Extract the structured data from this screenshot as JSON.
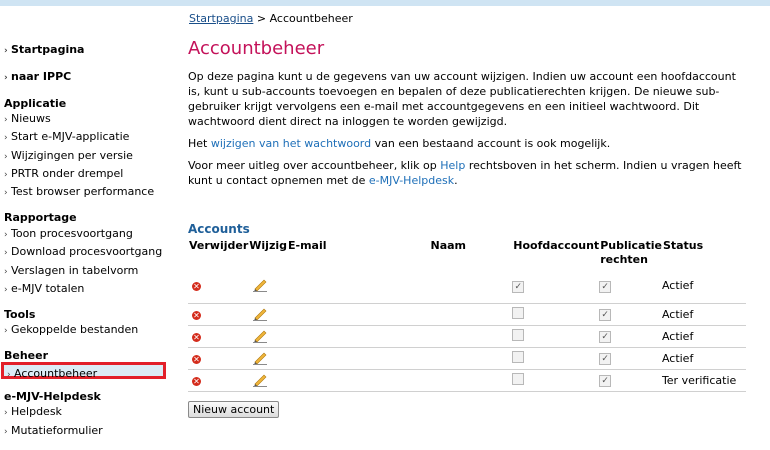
{
  "breadcrumb": {
    "home": "Startpagina",
    "separator": ">",
    "current": "Accountbeheer"
  },
  "sidebar": {
    "links": [
      {
        "label": "Startpagina"
      },
      {
        "label": "naar IPPC"
      }
    ],
    "sections": [
      {
        "title": "Applicatie",
        "items": [
          "Nieuws",
          "Start e-MJV-applicatie",
          "Wijzigingen per versie",
          "PRTR onder drempel",
          "Test browser performance"
        ]
      },
      {
        "title": "Rapportage",
        "items": [
          "Toon procesvoortgang",
          "Download procesvoortgang",
          "Verslagen in tabelvorm",
          "e-MJV totalen"
        ]
      },
      {
        "title": "Tools",
        "items": [
          "Gekoppelde bestanden"
        ]
      },
      {
        "title": "Beheer",
        "items": [
          "Accountbeheer"
        ]
      },
      {
        "title": "e-MJV-Helpdesk",
        "items": [
          "Helpdesk",
          "Mutatieformulier"
        ]
      }
    ]
  },
  "main": {
    "title": "Accountbeheer",
    "intro": "Op deze pagina kunt u de gegevens van uw account wijzigen. Indien uw account een hoofdaccount is, kunt u sub-accounts toevoegen en bepalen of deze publicatierechten krijgen. De nieuwe sub-gebruiker krijgt vervolgens een e-mail met accountgegevens en een initieel wachtwoord. Dit wachtwoord dient direct na inloggen te worden gewijzigd.",
    "pw_before": "Het ",
    "pw_link": "wijzigen van het wachtwoord",
    "pw_after": " van een bestaand account is ook mogelijk.",
    "help_before": "Voor meer uitleg over accountbeheer, klik op ",
    "help_link": "Help",
    "help_middle": " rechtsboven in het scherm. Indien u vragen heeft kunt u contact opnemen met de ",
    "helpdesk_link": "e-MJV-Helpdesk",
    "help_after": ".",
    "accounts_title": "Accounts",
    "columns": [
      "Verwijder",
      "Wijzig",
      "E-mail",
      "Naam",
      "Hoofdaccount",
      "Publicatie rechten",
      "Status"
    ],
    "rows": [
      {
        "email": "",
        "naam": "",
        "hoofdaccount": true,
        "publicatie": true,
        "status": "Actief"
      },
      {
        "email": "",
        "naam": "",
        "hoofdaccount": false,
        "publicatie": true,
        "status": "Actief"
      },
      {
        "email": "",
        "naam": "",
        "hoofdaccount": false,
        "publicatie": true,
        "status": "Actief"
      },
      {
        "email": "",
        "naam": "",
        "hoofdaccount": false,
        "publicatie": true,
        "status": "Actief"
      },
      {
        "email": "",
        "naam": "",
        "hoofdaccount": false,
        "publicatie": true,
        "status": "Ter verificatie"
      }
    ],
    "new_account_button": "Nieuw account"
  },
  "colors": {
    "title": "#c4125a",
    "link": "#1e6fb8",
    "section": "#1f5f99",
    "highlight_border": "#e2202a"
  },
  "icons": {
    "delete": "delete-circle-icon",
    "edit": "pencil-icon",
    "checkbox": "checkbox-icon"
  }
}
